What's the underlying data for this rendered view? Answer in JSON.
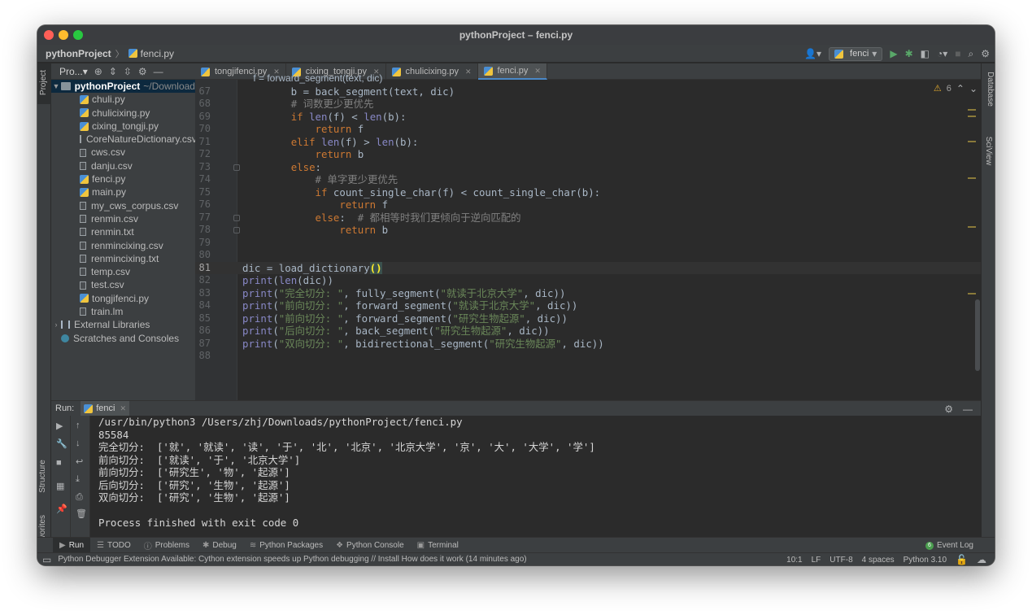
{
  "window": {
    "title": "pythonProject – fenci.py"
  },
  "navbar": {
    "project": "pythonProject",
    "file": "fenci.py",
    "run_config": "fenci"
  },
  "left_strip": {
    "project_label": "Project",
    "structure_label": "Structure",
    "favorites_label": "Favorites"
  },
  "right_strip": {
    "database_label": "Database",
    "sciview_label": "SciView"
  },
  "project_panel": {
    "header": "Pro...",
    "root_name": "pythonProject",
    "root_path": "~/Download",
    "files": [
      {
        "name": "chuli.py",
        "type": "py"
      },
      {
        "name": "chulicixing.py",
        "type": "py"
      },
      {
        "name": "cixing_tongji.py",
        "type": "py"
      },
      {
        "name": "CoreNatureDictionary.csv",
        "type": "file"
      },
      {
        "name": "cws.csv",
        "type": "file"
      },
      {
        "name": "danju.csv",
        "type": "file"
      },
      {
        "name": "fenci.py",
        "type": "py"
      },
      {
        "name": "main.py",
        "type": "py"
      },
      {
        "name": "my_cws_corpus.csv",
        "type": "file"
      },
      {
        "name": "renmin.csv",
        "type": "file"
      },
      {
        "name": "renmin.txt",
        "type": "file"
      },
      {
        "name": "renmincixing.csv",
        "type": "file"
      },
      {
        "name": "renmincixing.txt",
        "type": "file"
      },
      {
        "name": "temp.csv",
        "type": "file"
      },
      {
        "name": "test.csv",
        "type": "file"
      },
      {
        "name": "tongjifenci.py",
        "type": "py"
      },
      {
        "name": "train.lm",
        "type": "file"
      }
    ],
    "external_libraries": "External Libraries",
    "scratches": "Scratches and Consoles"
  },
  "tabs": [
    {
      "label": "tongjifenci.py",
      "active": false
    },
    {
      "label": "cixing_tongji.py",
      "active": false
    },
    {
      "label": "chulicixing.py",
      "active": false
    },
    {
      "label": "fenci.py",
      "active": true
    }
  ],
  "editor": {
    "warnings_count": "6",
    "lines": [
      {
        "n": "67",
        "html": "        b = back_segment(text, dic)"
      },
      {
        "n": "68",
        "html": "        <span class=\"cm\"># 词数更少更优先</span>"
      },
      {
        "n": "69",
        "html": "        <span class=\"kw\">if</span> <span class=\"bi\">len</span>(f) &lt; <span class=\"bi\">len</span>(b):"
      },
      {
        "n": "70",
        "html": "            <span class=\"kw\">return</span> f"
      },
      {
        "n": "71",
        "html": "        <span class=\"kw\">elif</span> <span class=\"bi\">len</span>(f) &gt; <span class=\"bi\">len</span>(b):"
      },
      {
        "n": "72",
        "html": "            <span class=\"kw\">return</span> b"
      },
      {
        "n": "73",
        "html": "        <span class=\"kw\">else</span>:"
      },
      {
        "n": "74",
        "html": "            <span class=\"cm\"># 单字更少更优先</span>"
      },
      {
        "n": "75",
        "html": "            <span class=\"kw\">if</span> count_single_char(f) &lt; count_single_char(b):"
      },
      {
        "n": "76",
        "html": "                <span class=\"kw\">return</span> f"
      },
      {
        "n": "77",
        "html": "            <span class=\"kw\">else</span>:  <span class=\"cm\"># 都相等时我们更倾向于逆向匹配的</span>"
      },
      {
        "n": "78",
        "html": "                <span class=\"kw\">return</span> b"
      },
      {
        "n": "79",
        "html": ""
      },
      {
        "n": "80",
        "html": ""
      },
      {
        "n": "81",
        "html": "dic = load_dictionary<span class=\"pb\">()</span>",
        "current": true
      },
      {
        "n": "82",
        "html": "<span class=\"bi\">print</span>(<span class=\"bi\">len</span>(dic))"
      },
      {
        "n": "83",
        "html": "<span class=\"bi\">print</span>(<span class=\"st\">\"完全切分: \"</span>, fully_segment(<span class=\"st\">\"就读于北京大学\"</span>, dic))"
      },
      {
        "n": "84",
        "html": "<span class=\"bi\">print</span>(<span class=\"st\">\"前向切分: \"</span>, forward_segment(<span class=\"st\">\"就读于北京大学\"</span>, dic))"
      },
      {
        "n": "85",
        "html": "<span class=\"bi\">print</span>(<span class=\"st\">\"前向切分: \"</span>, forward_segment(<span class=\"st\">\"研究生物起源\"</span>, dic))"
      },
      {
        "n": "86",
        "html": "<span class=\"bi\">print</span>(<span class=\"st\">\"后向切分: \"</span>, back_segment(<span class=\"st\">\"研究生物起源\"</span>, dic))"
      },
      {
        "n": "87",
        "html": "<span class=\"bi\">print</span>(<span class=\"st\">\"双向切分: \"</span>, bidirectional_segment(<span class=\"st\">\"研究生物起源\"</span>, dic))"
      },
      {
        "n": "88",
        "html": ""
      }
    ]
  },
  "run_panel": {
    "label": "Run:",
    "tab": "fenci",
    "output": [
      "/usr/bin/python3 /Users/zhj/Downloads/pythonProject/fenci.py",
      "85584",
      "完全切分:  ['就', '就读', '读', '于', '北', '北京', '北京大学', '京', '大', '大学', '学']",
      "前向切分:  ['就读', '于', '北京大学']",
      "前向切分:  ['研究生', '物', '起源']",
      "后向切分:  ['研究', '生物', '起源']",
      "双向切分:  ['研究', '生物', '起源']",
      "",
      "Process finished with exit code 0"
    ]
  },
  "tool_windows": [
    {
      "label": "Run",
      "icon": "play-icon",
      "glyph": "▶",
      "active": true
    },
    {
      "label": "TODO",
      "icon": "list-icon",
      "glyph": "☰",
      "active": false
    },
    {
      "label": "Problems",
      "icon": "info-icon",
      "glyph": "ⓘ",
      "active": false
    },
    {
      "label": "Debug",
      "icon": "bug-icon",
      "glyph": "✱",
      "active": false
    },
    {
      "label": "Python Packages",
      "icon": "layers-icon",
      "glyph": "≋",
      "active": false
    },
    {
      "label": "Python Console",
      "icon": "python-icon",
      "glyph": "❖",
      "active": false
    },
    {
      "label": "Terminal",
      "icon": "terminal-icon",
      "glyph": "▣",
      "active": false
    }
  ],
  "event_log": {
    "label": "Event Log",
    "badge": "6"
  },
  "status_bar": {
    "message": "Python Debugger Extension Available: Cython extension speeds up Python debugging // Install   How does it work (14 minutes ago)",
    "position": "10:1",
    "line_sep": "LF",
    "encoding": "UTF-8",
    "indent": "4 spaces",
    "interpreter": "Python 3.10"
  },
  "colors": {
    "accent": "#4a88c7",
    "editor_bg": "#2b2b2b",
    "panel_bg": "#3c3f41",
    "run_green": "#59a869"
  }
}
